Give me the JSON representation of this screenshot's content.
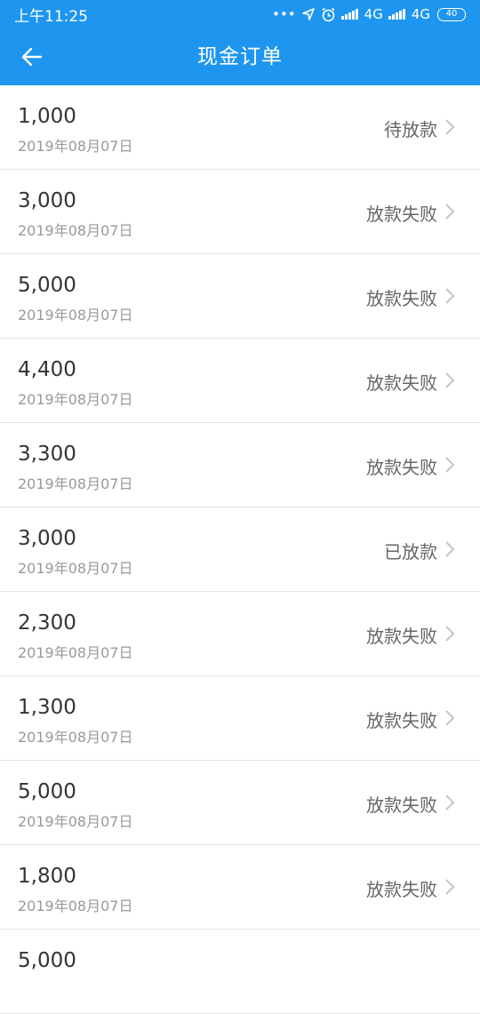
{
  "status_bar": {
    "time": "上午11:25",
    "dots": "•••",
    "net1": "4G",
    "net2": "4G",
    "battery": "40",
    "icons": [
      "location-arrow-icon",
      "alarm-icon",
      "signal-icon",
      "signal-icon"
    ]
  },
  "header": {
    "title": "现金订单",
    "back_icon": "arrow-left-icon"
  },
  "orders": [
    {
      "amount": "1,000",
      "date": "2019年08月07日",
      "status": "待放款"
    },
    {
      "amount": "3,000",
      "date": "2019年08月07日",
      "status": "放款失败"
    },
    {
      "amount": "5,000",
      "date": "2019年08月07日",
      "status": "放款失败"
    },
    {
      "amount": "4,400",
      "date": "2019年08月07日",
      "status": "放款失败"
    },
    {
      "amount": "3,300",
      "date": "2019年08月07日",
      "status": "放款失败"
    },
    {
      "amount": "3,000",
      "date": "2019年08月07日",
      "status": "已放款"
    },
    {
      "amount": "2,300",
      "date": "2019年08月07日",
      "status": "放款失败"
    },
    {
      "amount": "1,300",
      "date": "2019年08月07日",
      "status": "放款失败"
    },
    {
      "amount": "5,000",
      "date": "2019年08月07日",
      "status": "放款失败"
    },
    {
      "amount": "1,800",
      "date": "2019年08月07日",
      "status": "放款失败"
    },
    {
      "amount": "5,000",
      "date": "",
      "status": ""
    }
  ],
  "colors": {
    "primary": "#1e96f0",
    "amount": "#333333",
    "date": "#999999",
    "status": "#666666",
    "divider": "#e4e4e4"
  }
}
